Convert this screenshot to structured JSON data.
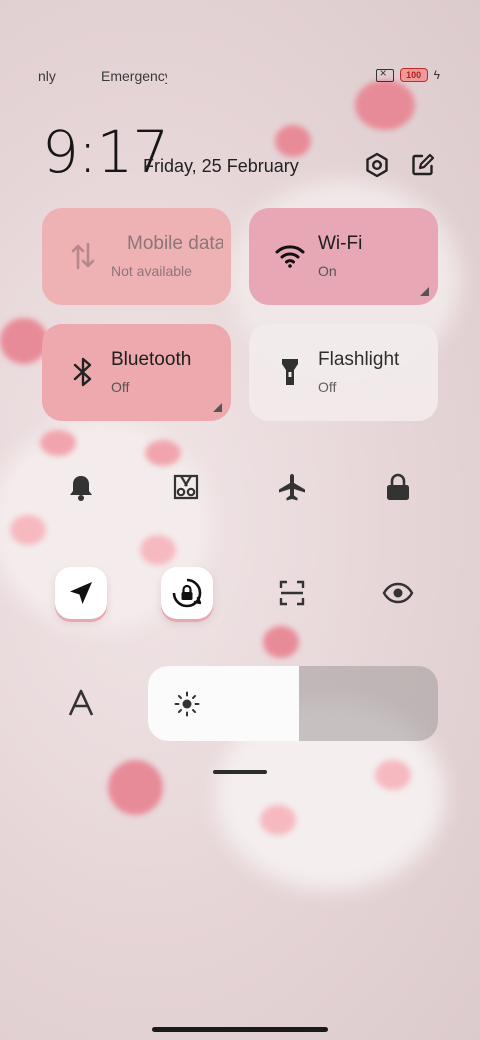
{
  "status_bar": {
    "carrier_1": "nly",
    "carrier_2": "Emergency",
    "battery_level": "100"
  },
  "header": {
    "time": "9:17",
    "date": "Friday, 25 February"
  },
  "tiles": [
    {
      "title": "Mobile data",
      "subtitle": "Not available",
      "state": "disabled",
      "icon": "mobile-data-icon"
    },
    {
      "title": "Wi-Fi",
      "subtitle": "On",
      "state": "on",
      "icon": "wifi-icon"
    },
    {
      "title": "Bluetooth",
      "subtitle": "Off",
      "state": "off",
      "icon": "bluetooth-icon"
    },
    {
      "title": "Flashlight",
      "subtitle": "Off",
      "state": "off",
      "icon": "flashlight-icon"
    }
  ],
  "toggles_row1": [
    "bell-icon",
    "screenshot-icon",
    "airplane-icon",
    "lock-icon"
  ],
  "toggles_row2": [
    "location-icon",
    "rotation-lock-icon",
    "scanner-icon",
    "eye-icon"
  ],
  "brightness": {
    "level": 0.52,
    "icon": "sun-icon"
  },
  "colors": {
    "tile_active": "#e8a7b5",
    "tile_disabled": "#eeb2b5",
    "tile_off": "#eda9ae",
    "tile_inactive": "#f3ecec"
  }
}
